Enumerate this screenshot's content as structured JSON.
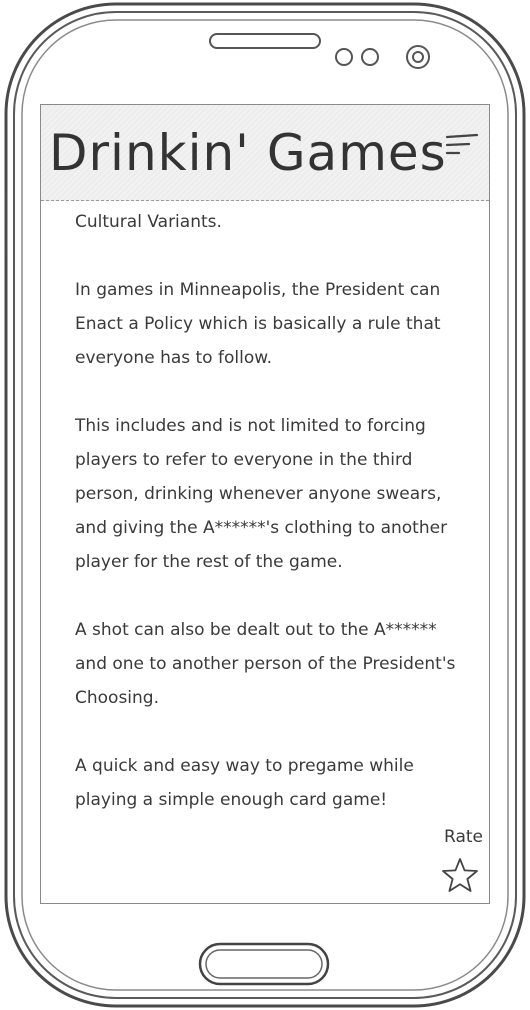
{
  "app": {
    "title": "Drinkin' Games"
  },
  "content": {
    "heading": "Cultural Variants.",
    "paragraphs": [
      "In games in Minneapolis, the President can Enact a Policy which is basically a rule that everyone has to follow.",
      "This includes and is not limited to forcing players to refer to everyone in the third person, drinking whenever anyone swears, and giving the A******'s clothing to another player for the rest of the game.",
      "A shot can also be dealt out to the A****** and one to another person of the President's Choosing.",
      "A quick and easy way to pregame while playing a simple enough card game!"
    ]
  },
  "rating": {
    "label": "Rate"
  },
  "icons": {
    "menu": "menu-icon",
    "star": "star-icon",
    "home": "home-button",
    "camera": "camera-icon",
    "speaker": "speaker-icon"
  }
}
